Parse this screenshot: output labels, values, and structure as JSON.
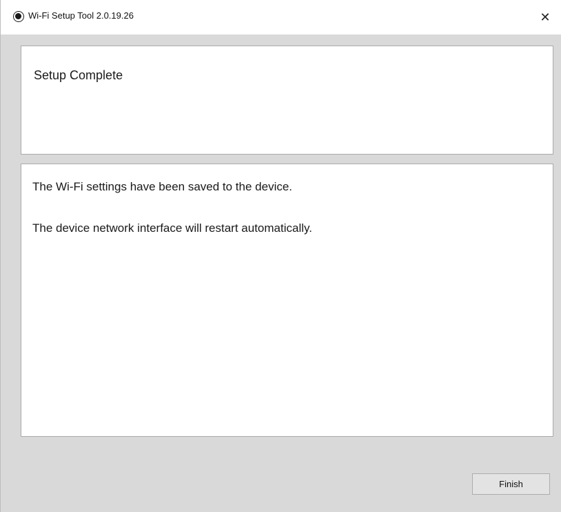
{
  "window": {
    "title": "Wi-Fi Setup Tool 2.0.19.26",
    "app_icon": "radio-circle-icon",
    "close_icon": "close-icon",
    "close_glyph": "✕"
  },
  "header": {
    "title": "Setup Complete"
  },
  "content": {
    "messages": [
      "The Wi-Fi settings have been saved to the device.",
      "The device network interface will restart automatically."
    ]
  },
  "footer": {
    "finish_label": "Finish"
  },
  "colors": {
    "window_bg": "#d9d9d9",
    "panel_bg": "#ffffff",
    "panel_border": "#a9a9a9",
    "button_bg": "#e3e3e3"
  }
}
